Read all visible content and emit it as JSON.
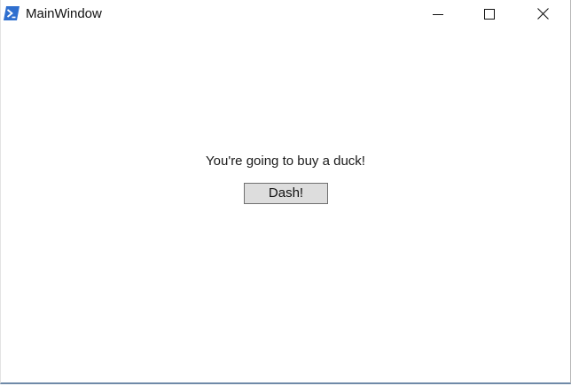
{
  "window": {
    "title": "MainWindow",
    "icon": "powershell-icon"
  },
  "titlebar_buttons": {
    "minimize_icon": "minimize-icon",
    "maximize_icon": "maximize-icon",
    "close_icon": "close-icon"
  },
  "content": {
    "message": "You're going to buy a duck!",
    "button_label": "Dash!"
  },
  "colors": {
    "icon_blue": "#2f6fcf",
    "button_face": "#dddddd",
    "button_border": "#707070"
  }
}
